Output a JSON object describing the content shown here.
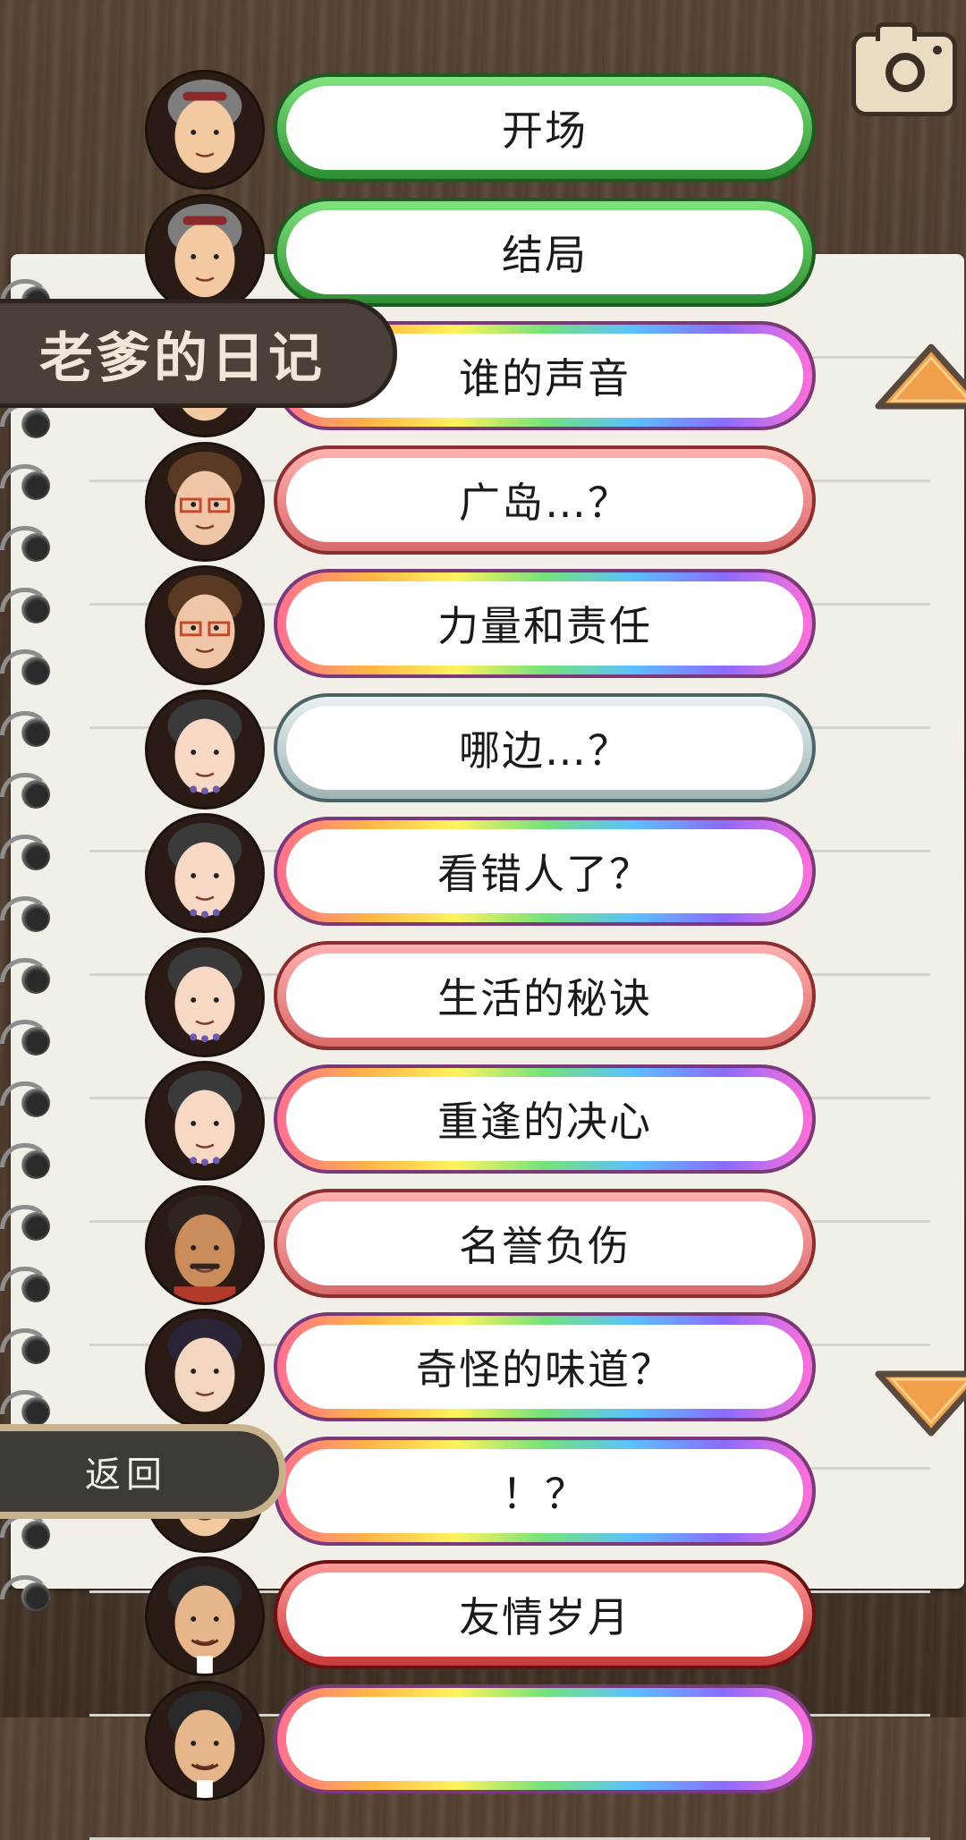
{
  "page": {
    "title": "老爹的日记",
    "back_label": "返回"
  },
  "episodes": [
    {
      "label": "开场",
      "frame": "green",
      "avatar": "old-man"
    },
    {
      "label": "结局",
      "frame": "green",
      "avatar": "old-man"
    },
    {
      "label": "谁的声音",
      "frame": "rainbow",
      "avatar": "hidden"
    },
    {
      "label": "广岛…？",
      "frame": "pink",
      "avatar": "glasses-lady"
    },
    {
      "label": "力量和责任",
      "frame": "rainbow",
      "avatar": "glasses-lady"
    },
    {
      "label": "哪边…？",
      "frame": "silver",
      "avatar": "round-lady"
    },
    {
      "label": "看错人了？",
      "frame": "rainbow",
      "avatar": "round-lady"
    },
    {
      "label": "生活的秘诀",
      "frame": "pink",
      "avatar": "round-lady"
    },
    {
      "label": "重逢的决心",
      "frame": "rainbow",
      "avatar": "round-lady"
    },
    {
      "label": "名誉负伤",
      "frame": "pink",
      "avatar": "mustache-man"
    },
    {
      "label": "奇怪的味道？",
      "frame": "rainbow",
      "avatar": "bob-girl"
    },
    {
      "label": "！？",
      "frame": "rainbow",
      "avatar": "hidden"
    },
    {
      "label": "友情岁月",
      "frame": "red",
      "avatar": "smiling-man"
    },
    {
      "label": "",
      "frame": "rainbow",
      "avatar": "smiling-man"
    }
  ],
  "colors": {
    "arrow": "#f0a04a",
    "arrow_border": "#5a4a3e",
    "tab_bg": "#4a4038"
  },
  "icons": {
    "camera": "camera-icon",
    "scroll_up": "triangle-up-icon",
    "scroll_down": "triangle-down-icon"
  }
}
